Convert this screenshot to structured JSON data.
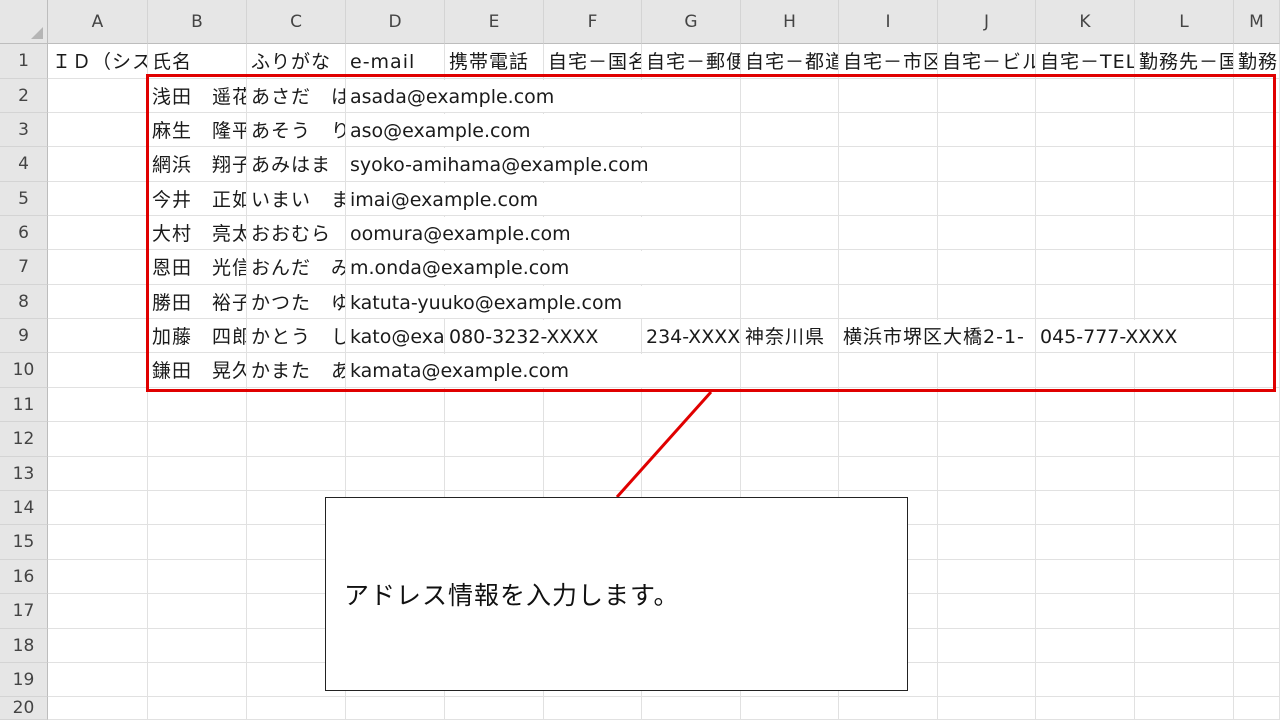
{
  "columns": [
    "A",
    "B",
    "C",
    "D",
    "E",
    "F",
    "G",
    "H",
    "I",
    "J",
    "K",
    "L",
    "M"
  ],
  "rows": [
    "1",
    "2",
    "3",
    "4",
    "5",
    "6",
    "7",
    "8",
    "9",
    "10",
    "11",
    "12",
    "13",
    "14",
    "15",
    "16",
    "17",
    "18",
    "19",
    "20"
  ],
  "header_row": {
    "A": "ＩＤ（シス",
    "B": "氏名",
    "C": "ふりがな",
    "D": "e-mail",
    "E": "携帯電話",
    "F": "自宅－国名",
    "G": "自宅－郵便",
    "H": "自宅－都道",
    "I": "自宅－市区",
    "J": "自宅－ビル",
    "K": "自宅－TEL",
    "L": "勤務先－国",
    "M": "勤務"
  },
  "records": [
    {
      "name": "浅田　遥花",
      "kana": "あさだ　は",
      "email": "asada@example.com",
      "mobile": "",
      "zip": "",
      "pref": "",
      "city": "",
      "tel": ""
    },
    {
      "name": "麻生　隆平",
      "kana": "あそう　り",
      "email": "aso@example.com",
      "mobile": "",
      "zip": "",
      "pref": "",
      "city": "",
      "tel": ""
    },
    {
      "name": "網浜　翔子",
      "kana": "あみはま",
      "email": "syoko-amihama@example.com",
      "mobile": "",
      "zip": "",
      "pref": "",
      "city": "",
      "tel": ""
    },
    {
      "name": "今井　正如",
      "kana": "いまい　ま",
      "email": "imai@example.com",
      "mobile": "",
      "zip": "",
      "pref": "",
      "city": "",
      "tel": ""
    },
    {
      "name": "大村　亮太",
      "kana": "おおむら",
      "email": "oomura@example.com",
      "mobile": "",
      "zip": "",
      "pref": "",
      "city": "",
      "tel": ""
    },
    {
      "name": "恩田　光信",
      "kana": "おんだ　み",
      "email": "m.onda@example.com",
      "mobile": "",
      "zip": "",
      "pref": "",
      "city": "",
      "tel": ""
    },
    {
      "name": "勝田　裕子",
      "kana": "かつた　ゆ",
      "email": "katuta-yuuko@example.com",
      "mobile": "",
      "zip": "",
      "pref": "",
      "city": "",
      "tel": ""
    },
    {
      "name": "加藤　四郎",
      "kana": "かとう　し",
      "email": "kato@exa",
      "mobile": "080-3232-XXXX",
      "zip": "234-XXXX",
      "pref": "神奈川県",
      "city": "横浜市堺区大橋2-1-",
      "tel": "045-777-XXXX"
    },
    {
      "name": "鎌田　晃久",
      "kana": "かまた　あ",
      "email": "kamata@example.com",
      "mobile": "",
      "zip": "",
      "pref": "",
      "city": "",
      "tel": ""
    }
  ],
  "callout": {
    "text": "アドレス情報を入力します。"
  },
  "colors": {
    "selection_border": "#e00000",
    "header_bg": "#e6e6e6",
    "gridline": "#e1e1e1"
  }
}
